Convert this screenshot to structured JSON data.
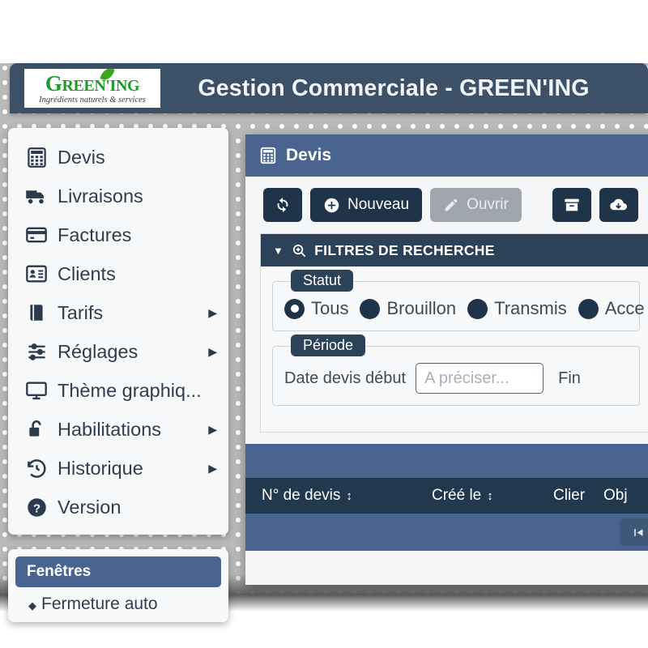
{
  "header": {
    "title": "Gestion Commerciale - GREEN'ING",
    "logo_main": "REEN'ING",
    "logo_main_cap": "G",
    "logo_sub": "Ingrédients naturels & services",
    "brand_green": "#1a9e27",
    "bar_color": "#3c5068"
  },
  "sidebar": {
    "items": [
      {
        "label": "Devis",
        "icon": "calculator-icon",
        "arrow": ""
      },
      {
        "label": "Livraisons",
        "icon": "truck-icon",
        "arrow": ""
      },
      {
        "label": "Factures",
        "icon": "card-icon",
        "arrow": ""
      },
      {
        "label": "Clients",
        "icon": "id-card-icon",
        "arrow": ""
      },
      {
        "label": "Tarifs",
        "icon": "book-icon",
        "arrow": "▶"
      },
      {
        "label": "Réglages",
        "icon": "sliders-icon",
        "arrow": "▶"
      },
      {
        "label": "Thème graphiq...",
        "icon": "monitor-icon",
        "arrow": ""
      },
      {
        "label": "Habilitations",
        "icon": "lock-open-icon",
        "arrow": "▶"
      },
      {
        "label": "Historique",
        "icon": "history-icon",
        "arrow": "▶"
      },
      {
        "label": "Version",
        "icon": "question-icon",
        "arrow": ""
      }
    ]
  },
  "fenetres": {
    "title": "Fenêtres",
    "item_bullet": "◆",
    "item_label": "Fermeture auto"
  },
  "window": {
    "title": "Devis",
    "title_icon": "calculator-icon",
    "toolbar": {
      "refresh_icon": "refresh-icon",
      "new_label": "Nouveau",
      "new_icon": "plus-circle-icon",
      "open_label": "Ouvrir",
      "open_icon": "pencil-icon",
      "archive_icon": "archive-box-icon",
      "download_icon": "cloud-download-icon"
    },
    "filters": {
      "title": "FILTRES DE RECHERCHE",
      "caret": "▼",
      "search_icon": "zoom-in-icon",
      "statut": {
        "legend": "Statut",
        "options": [
          {
            "label": "Tous",
            "selected": true
          },
          {
            "label": "Brouillon",
            "selected": false
          },
          {
            "label": "Transmis",
            "selected": false
          },
          {
            "label": "Acce",
            "selected": false
          }
        ]
      },
      "periode": {
        "legend": "Période",
        "date_start_label": "Date devis début",
        "date_start_value": "",
        "date_start_placeholder": "A préciser...",
        "date_end_label": "Fin"
      }
    },
    "grid": {
      "columns": [
        {
          "label": "N° de devis",
          "sortable": true,
          "sort_icon": "↕"
        },
        {
          "label": "Créé le",
          "sortable": true,
          "sort_icon": "↕"
        },
        {
          "label": "Clier",
          "sortable": false,
          "sort_icon": ""
        },
        {
          "label": "Obj",
          "sortable": false,
          "sort_icon": ""
        }
      ],
      "rows": [],
      "pagination": {
        "first_label": "◀",
        "first_icon": "first-page-icon"
      }
    }
  },
  "theme": {
    "navy_dark": "#1f3349",
    "navy_header": "#22384e",
    "blue_mid": "#4a6490",
    "panel_bg": "#f4f6f8"
  }
}
